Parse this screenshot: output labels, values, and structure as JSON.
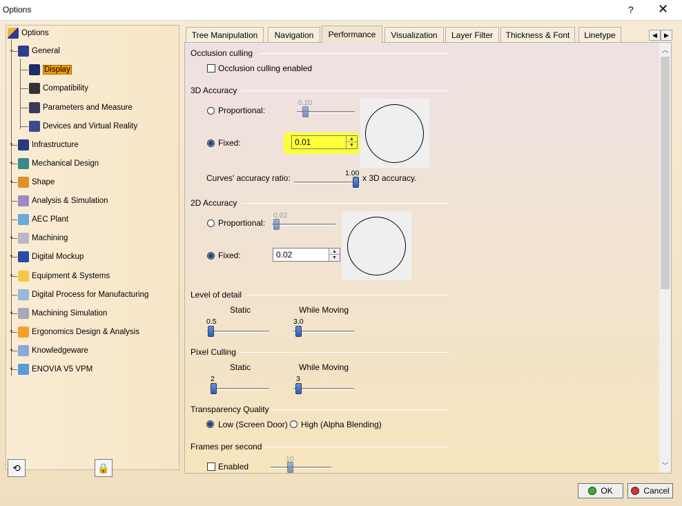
{
  "window": {
    "title": "Options",
    "help": "?",
    "close": "✕"
  },
  "tree": {
    "root": "Options",
    "items": [
      {
        "label": "General",
        "icon": "general-icon",
        "color": "#2b3f8f"
      },
      {
        "label": "Display",
        "icon": "display-icon",
        "color": "#1c2d6a",
        "selected": true
      },
      {
        "label": "Compatibility",
        "icon": "compatibility-icon",
        "color": "#333333"
      },
      {
        "label": "Parameters and Measure",
        "icon": "parameters-icon",
        "color": "#3a3a5a"
      },
      {
        "label": "Devices and Virtual Reality",
        "icon": "devices-icon",
        "color": "#3a4a8a"
      },
      {
        "label": "Infrastructure",
        "icon": "infrastructure-icon",
        "color": "#2a3a7a"
      },
      {
        "label": "Mechanical Design",
        "icon": "mechanical-design-icon",
        "color": "#3a8a8a"
      },
      {
        "label": "Shape",
        "icon": "shape-icon",
        "color": "#e0902a"
      },
      {
        "label": "Analysis & Simulation",
        "icon": "analysis-icon",
        "color": "#9a8ac8"
      },
      {
        "label": "AEC Plant",
        "icon": "aec-plant-icon",
        "color": "#6aaad8"
      },
      {
        "label": "Machining",
        "icon": "machining-icon",
        "color": "#b8b8c8"
      },
      {
        "label": "Digital Mockup",
        "icon": "digital-mockup-icon",
        "color": "#2a4aa8"
      },
      {
        "label": "Equipment & Systems",
        "icon": "equipment-icon",
        "color": "#f2c84a"
      },
      {
        "label": "Digital Process for Manufacturing",
        "icon": "digital-process-icon",
        "color": "#9ab8d8"
      },
      {
        "label": "Machining Simulation",
        "icon": "machining-simulation-icon",
        "color": "#a8a8b8"
      },
      {
        "label": "Ergonomics Design & Analysis",
        "icon": "ergonomics-icon",
        "color": "#f2a02a"
      },
      {
        "label": "Knowledgeware",
        "icon": "knowledgeware-icon",
        "color": "#8aa8d8"
      },
      {
        "label": "ENOVIA V5 VPM",
        "icon": "enovia-icon",
        "color": "#5a9ad8"
      }
    ]
  },
  "tabs": [
    {
      "label": "Tree Manipulation"
    },
    {
      "label": "Navigation"
    },
    {
      "label": "Performance",
      "active": true
    },
    {
      "label": "Visualization"
    },
    {
      "label": "Layer Filter"
    },
    {
      "label": "Thickness & Font"
    },
    {
      "label": "Linetype"
    }
  ],
  "occlusion": {
    "title": "Occlusion culling",
    "checkbox": "Occlusion culling enabled",
    "checked": false
  },
  "acc3d": {
    "title": "3D Accuracy",
    "proportional": "Proportional:",
    "proportional_value": "0.20",
    "fixed": "Fixed:",
    "fixed_value": "0.01",
    "selected": "fixed",
    "curves_label": "Curves' accuracy ratio:",
    "curves_value": "1.00",
    "curves_suffix": "x 3D accuracy."
  },
  "acc2d": {
    "title": "2D Accuracy",
    "proportional": "Proportional:",
    "proportional_value": "0.02",
    "fixed": "Fixed:",
    "fixed_value": "0.02",
    "selected": "fixed"
  },
  "lod": {
    "title": "Level of detail",
    "static": "Static",
    "moving": "While Moving",
    "static_value": "0.5",
    "moving_value": "3.0"
  },
  "pixel": {
    "title": "Pixel Culling",
    "static": "Static",
    "moving": "While Moving",
    "static_value": "2",
    "moving_value": "3"
  },
  "transparency": {
    "title": "Transparency Quality",
    "low": "Low (Screen Door)",
    "high": "High (Alpha Blending)",
    "selected": "low"
  },
  "fps": {
    "title": "Frames per second",
    "checkbox": "Enabled",
    "checked": false,
    "value": "10"
  },
  "buttons": {
    "ok": "OK",
    "cancel": "Cancel"
  },
  "colors": {
    "highlight": "#ffff3a",
    "selection": "#f29900",
    "ok_dot": "#2fb52f",
    "cancel_dot": "#d83030"
  }
}
